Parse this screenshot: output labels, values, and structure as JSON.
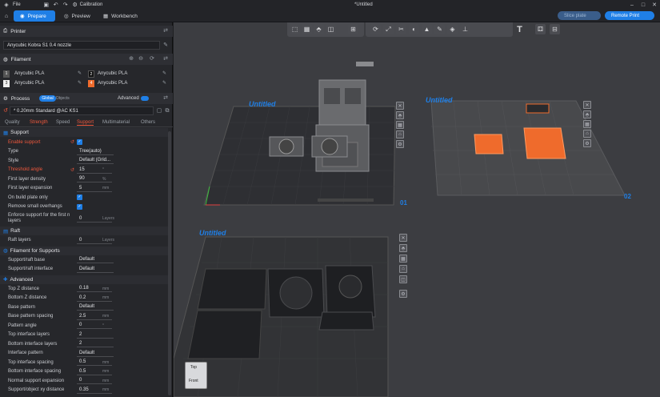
{
  "titlebar": {
    "file_label": "File",
    "calibration_label": "Calibration",
    "doc_title": "*Untitled"
  },
  "menubar": {
    "tabs": [
      {
        "label": "Prepare"
      },
      {
        "label": "Preview"
      },
      {
        "label": "Workbench"
      }
    ],
    "slice_label": "Slice plate",
    "print_label": "Remote Print"
  },
  "printer": {
    "section_label": "Printer",
    "name": "Anycubic Kobra S1 0.4 nozzle"
  },
  "filament": {
    "section_label": "Filament",
    "slots": [
      {
        "num": "1",
        "name": "Anycubic PLA",
        "color": "#555555"
      },
      {
        "num": "2",
        "name": "Anycubic PLA",
        "color": "#222222"
      },
      {
        "num": "3",
        "name": "Anycubic PLA",
        "color": "#eeeeee"
      },
      {
        "num": "4",
        "name": "Anycubic PLA",
        "color": "#ef6b2c"
      }
    ]
  },
  "process": {
    "section_label": "Process",
    "global_label": "Global",
    "objects_label": "Objects",
    "advanced_label": "Advanced",
    "preset": "* 0.20mm Standard @AC KS1",
    "tabs": [
      "Quality",
      "Strength",
      "Speed",
      "Support",
      "Multimaterial",
      "Others"
    ]
  },
  "support": {
    "header": "Support",
    "rows": [
      {
        "label": "Enable support",
        "type": "check",
        "red": true
      },
      {
        "label": "Type",
        "value": "Tree(auto)"
      },
      {
        "label": "Style",
        "value": "Default (Grid..."
      },
      {
        "label": "Threshold angle",
        "value": "15",
        "red": true,
        "unit": "°"
      },
      {
        "label": "First layer density",
        "value": "90",
        "unit": "%"
      },
      {
        "label": "First layer expansion",
        "value": "5",
        "unit": "mm"
      },
      {
        "label": "On build plate only",
        "type": "check"
      },
      {
        "label": "Remove small overhangs",
        "type": "check"
      },
      {
        "label": "Enforce support for the first n layers",
        "value": "0",
        "unit": "Layers"
      }
    ]
  },
  "raft": {
    "header": "Raft",
    "rows": [
      {
        "label": "Raft layers",
        "value": "0",
        "unit": "Layers"
      }
    ]
  },
  "filament_supports": {
    "header": "Filament for Supports",
    "rows": [
      {
        "label": "Support/raft base",
        "value": "Default"
      },
      {
        "label": "Support/raft interface",
        "value": "Default"
      }
    ]
  },
  "advanced": {
    "header": "Advanced",
    "rows": [
      {
        "label": "Top Z distance",
        "value": "0.18",
        "unit": "mm"
      },
      {
        "label": "Bottom Z distance",
        "value": "0.2",
        "unit": "mm"
      },
      {
        "label": "Base pattern",
        "value": "Default"
      },
      {
        "label": "Base pattern spacing",
        "value": "2.5",
        "unit": "mm"
      },
      {
        "label": "Pattern angle",
        "value": "0",
        "unit": "°"
      },
      {
        "label": "Top interface layers",
        "value": "2"
      },
      {
        "label": "Bottom interface layers",
        "value": "2"
      },
      {
        "label": "Interface pattern",
        "value": "Default"
      },
      {
        "label": "Top interface spacing",
        "value": "0.5",
        "unit": "mm"
      },
      {
        "label": "Bottom interface spacing",
        "value": "0.5",
        "unit": "mm"
      },
      {
        "label": "Normal support expansion",
        "value": "0",
        "unit": "mm"
      },
      {
        "label": "Support/object xy distance",
        "value": "0.35",
        "unit": "mm"
      }
    ]
  },
  "viewport": {
    "plate1_label": "Untitled",
    "plate1_num": "01",
    "plate2_label": "Untitled",
    "plate2_num": "02",
    "plate3_label": "Untitled",
    "viewcube_top": "Top",
    "viewcube_front": "Front"
  }
}
